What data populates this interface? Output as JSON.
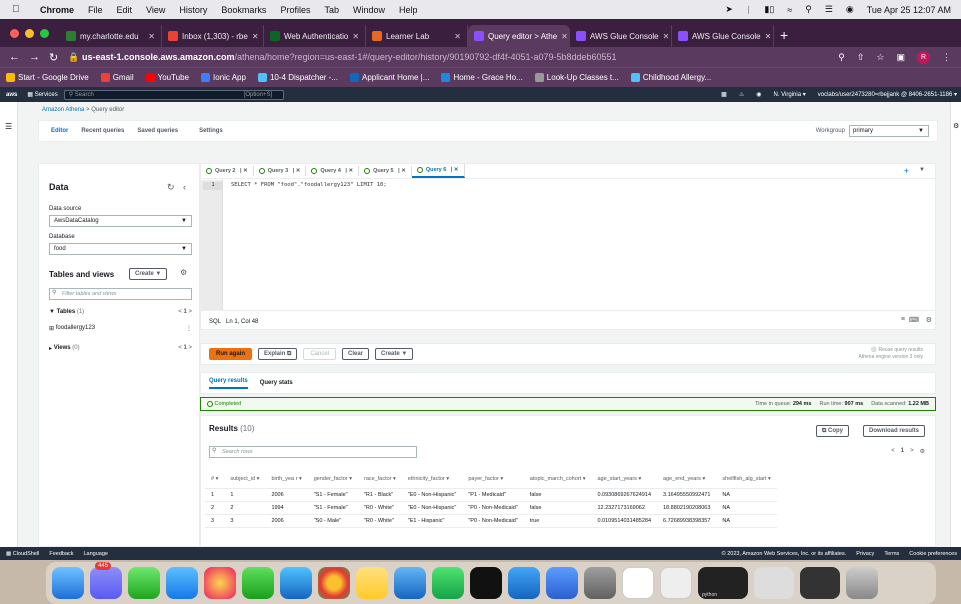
{
  "menubar": {
    "app": "Chrome",
    "items": [
      "File",
      "Edit",
      "View",
      "History",
      "Bookmarks",
      "Profiles",
      "Tab",
      "Window",
      "Help"
    ],
    "datetime": "Tue Apr 25  12:07 AM"
  },
  "tabs": [
    {
      "label": "my.charlotte.edu",
      "color": "#2e7d32"
    },
    {
      "label": "Inbox (1,303) - rbe",
      "color": "#ea4335"
    },
    {
      "label": "Web Authenticatio",
      "color": "#0b6623"
    },
    {
      "label": "Learner Lab",
      "color": "#e8681f"
    },
    {
      "label": "Query editor > Athe",
      "color": "#8c4fff",
      "active": true
    },
    {
      "label": "AWS Glue Console",
      "color": "#8c4fff"
    },
    {
      "label": "AWS Glue Console",
      "color": "#8c4fff"
    }
  ],
  "address": {
    "host": "us-east-1.console.aws.amazon.com",
    "path": "/athena/home?region=us-east-1#/query-editor/history/90190792-df4f-4051-a079-5b8ddeb60551",
    "profile": "R"
  },
  "bookmarks": [
    {
      "label": "Start - Google Drive",
      "color": "#fbbc04"
    },
    {
      "label": "Gmail",
      "color": "#ea4335"
    },
    {
      "label": "YouTube",
      "color": "#ff0000"
    },
    {
      "label": "Ionic App",
      "color": "#3880ff"
    },
    {
      "label": "10-4 Dispatcher -...",
      "color": "#4fc3f7"
    },
    {
      "label": "Applicant Home |...",
      "color": "#1565c0"
    },
    {
      "label": "Home - Grace Ho...",
      "color": "#1e88e5"
    },
    {
      "label": "Look-Up Classes t...",
      "color": "#999999"
    },
    {
      "label": "Childhood Allergy...",
      "color": "#4fc3f7"
    }
  ],
  "awsnav": {
    "services": "Services",
    "search_placeholder": "Search",
    "search_hint": "[Option+S]",
    "region": "N. Virginia ▾",
    "account": "voclabs/user2473280=rbejjank @ 8406-2651-1186 ▾"
  },
  "breadcrumb": {
    "root": "Amazon Athena",
    "sep": ">",
    "current": "Query editor"
  },
  "pagetabs": [
    "Editor",
    "Recent queries",
    "Saved queries",
    "Settings"
  ],
  "workgroup": {
    "label": "Workgroup",
    "value": "primary"
  },
  "datapanel": {
    "title": "Data",
    "source_label": "Data source",
    "source_value": "AwsDataCatalog",
    "db_label": "Database",
    "db_value": "food",
    "tv_title": "Tables and views",
    "create": "Create",
    "filter_placeholder": "Filter tables and views",
    "tables": "Tables",
    "tables_count": "(1)",
    "table_name": "foodallergy123",
    "views": "Views",
    "views_count": "(0)",
    "page": "1"
  },
  "querytabs": [
    "Query 2",
    "Query 3",
    "Query 4",
    "Query 5",
    "Query 6"
  ],
  "editor": {
    "line_no": "1",
    "sql": "SELECT * FROM \"food\".\"foodallergy123\" LIMIT 10;",
    "lang": "SQL",
    "cursor": "Ln 1, Col 48"
  },
  "buttons": {
    "run": "Run again",
    "explain": "Explain",
    "cancel": "Cancel",
    "clear": "Clear",
    "create": "Create",
    "reuse": "Reuse query results",
    "engine": "Athena engine version 3 only"
  },
  "resulttabs": [
    "Query results",
    "Query stats"
  ],
  "status": {
    "state": "Completed",
    "queue_label": "Time in queue:",
    "queue": "294 ms",
    "run_label": "Run time:",
    "run": "907 ms",
    "scan_label": "Data scanned:",
    "scan": "1.22 MB"
  },
  "results": {
    "title": "Results",
    "count": "(10)",
    "search_placeholder": "Search rows",
    "copy": "Copy",
    "download": "Download results",
    "page": "1",
    "columns": [
      "#",
      "subject_id",
      "birth_yea r",
      "gender_factor",
      "race_factor",
      "ethnicity_factor",
      "payer_factor",
      "atopic_march_cohort",
      "age_start_years",
      "age_end_years",
      "shellfish_alg_start"
    ],
    "rows": [
      [
        "1",
        "1",
        "2006",
        "\"S1 - Female\"",
        "\"R1 - Black\"",
        "\"E0 - Non-Hispanic\"",
        "\"P1 - Medicaid\"",
        "false",
        "0.0930869267624914",
        "3.16495550992471",
        "NA"
      ],
      [
        "2",
        "2",
        "1994",
        "\"S1 - Female\"",
        "\"R0 - White\"",
        "\"E0 - Non-Hispanic\"",
        "\"P0 - Non-Medicaid\"",
        "false",
        "12.2327173169062",
        "18.8802190208063",
        "NA"
      ],
      [
        "3",
        "3",
        "2006",
        "\"S0 - Male\"",
        "\"R0 - White\"",
        "\"E1 - Hispanic\"",
        "\"P0 - Non-Medicaid\"",
        "true",
        "0.0109514031485284",
        "6.72689938398357",
        "NA"
      ]
    ]
  },
  "footer": {
    "cloudshell": "CloudShell",
    "feedback": "Feedback",
    "language": "Language",
    "copyright": "© 2023, Amazon Web Services, Inc. or its affiliates.",
    "privacy": "Privacy",
    "terms": "Terms",
    "cookie": "Cookie preferences"
  },
  "dock": {
    "badge": "445",
    "python_label": "python"
  }
}
